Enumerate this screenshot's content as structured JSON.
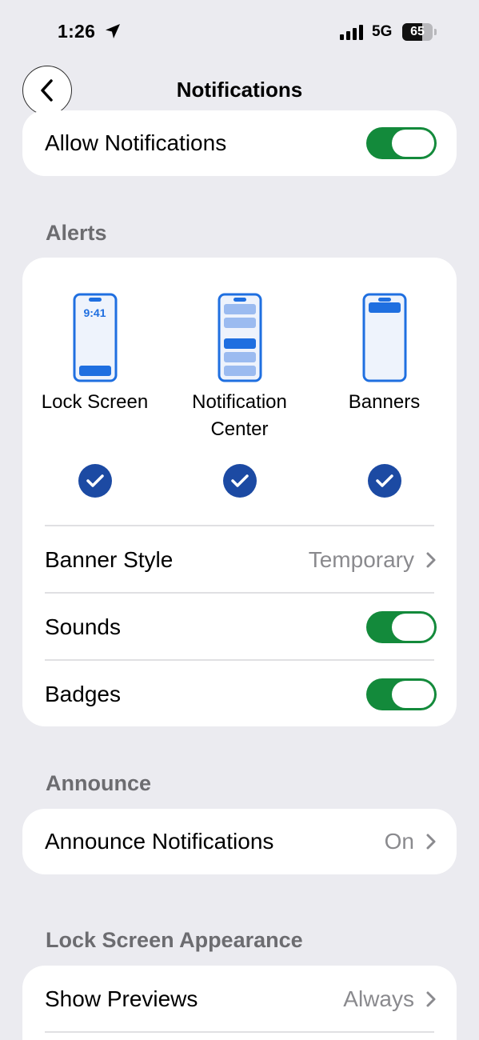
{
  "status_bar": {
    "time": "1:26",
    "network": "5G",
    "battery": "65",
    "battery_level": 0.65
  },
  "nav": {
    "title": "Notifications"
  },
  "allow_notifications": {
    "label": "Allow Notifications",
    "on": true
  },
  "alerts": {
    "header": "Alerts",
    "options": [
      {
        "label": "Lock Screen",
        "preview_time": "9:41",
        "checked": true
      },
      {
        "label": "Notification Center",
        "checked": true
      },
      {
        "label": "Banners",
        "checked": true
      }
    ],
    "banner_style": {
      "label": "Banner Style",
      "value": "Temporary"
    },
    "sounds": {
      "label": "Sounds",
      "on": true
    },
    "badges": {
      "label": "Badges",
      "on": true
    }
  },
  "announce": {
    "header": "Announce",
    "announce_notifications": {
      "label": "Announce Notifications",
      "value": "On"
    }
  },
  "lock_screen_appearance": {
    "header": "Lock Screen Appearance",
    "show_previews": {
      "label": "Show Previews",
      "value": "Always"
    }
  },
  "colors": {
    "accent_green": "#138a3b",
    "check_blue": "#1c4aa3",
    "phone_blue": "#1f6fe0"
  }
}
